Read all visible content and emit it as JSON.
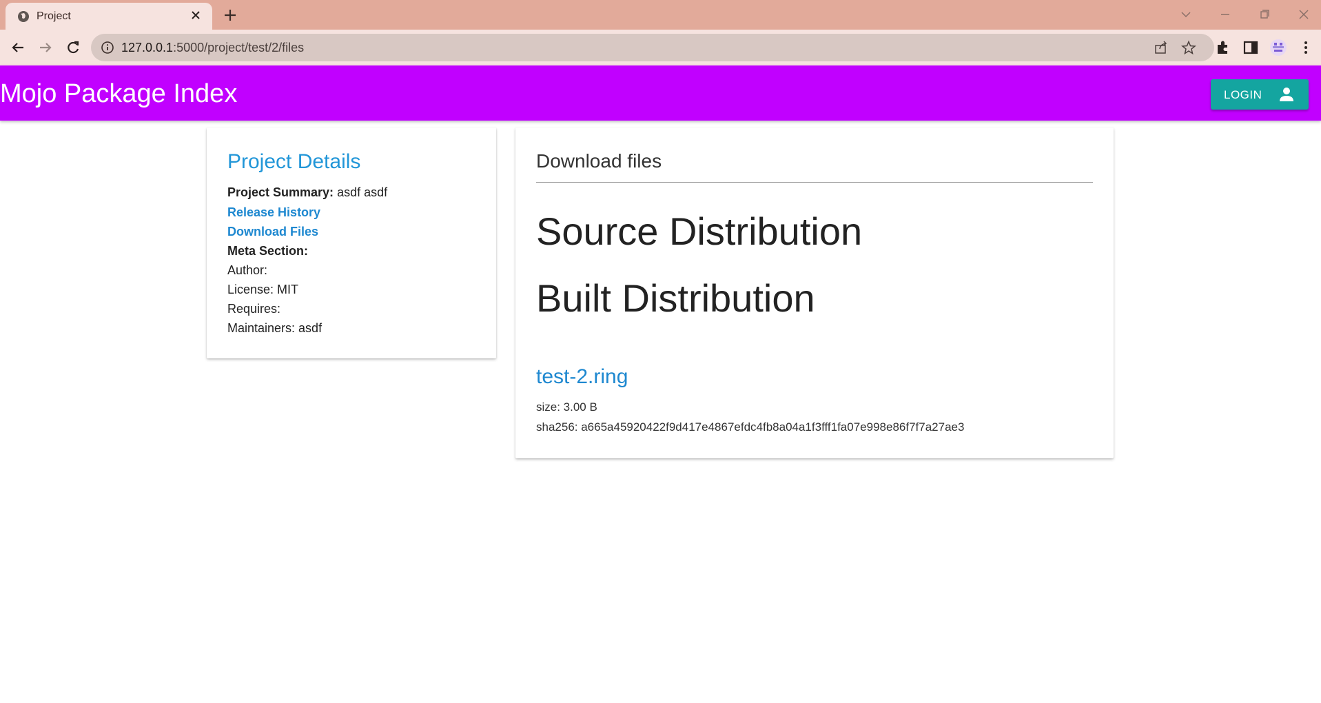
{
  "browser": {
    "tab_title": "Project",
    "url_host": "127.0.0.1",
    "url_rest": ":5000/project/test/2/files"
  },
  "app": {
    "brand": "Mojo Package Index",
    "login_label": "LOGIN",
    "colors": {
      "appbar": "#c100ff",
      "login": "#14a5a0",
      "link": "#1e88d0"
    }
  },
  "details": {
    "title": "Project Details",
    "summary_label": "Project Summary:",
    "summary_value": "asdf asdf",
    "release_history": "Release History",
    "download_files": "Download Files",
    "meta_label": "Meta Section:",
    "author": "Author:",
    "license": "License: MIT",
    "requires": "Requires:",
    "maintainers": "Maintainers: asdf"
  },
  "downloads": {
    "title": "Download files",
    "source_heading": "Source Distribution",
    "built_heading": "Built Distribution",
    "files": [
      {
        "name": "test-2.ring",
        "size": "size: 3.00 B",
        "sha256": "sha256: a665a45920422f9d417e4867efdc4fb8a04a1f3fff1fa07e998e86f7f7a27ae3"
      }
    ]
  },
  "icons": [
    "globe-icon",
    "close-icon",
    "plus-icon",
    "back-arrow-icon",
    "forward-arrow-icon",
    "reload-icon",
    "info-icon",
    "share-icon",
    "star-icon",
    "puzzle-icon",
    "side-panel-icon",
    "profile-icon",
    "kebab-menu-icon",
    "person-icon"
  ]
}
